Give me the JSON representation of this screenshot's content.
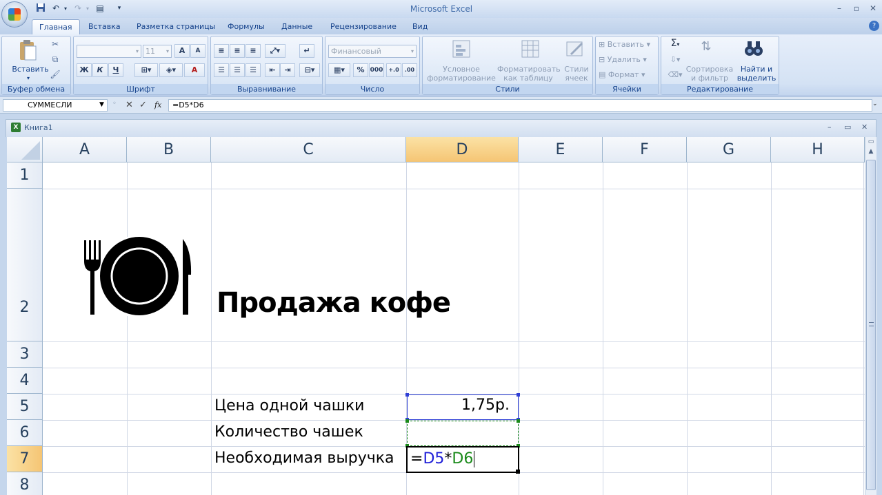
{
  "app": {
    "title": "Microsoft Excel"
  },
  "quick_access": {
    "save_icon": "save-icon",
    "undo_icon": "undo-icon",
    "redo_icon": "redo-icon",
    "customize_icon": "customize-icon"
  },
  "tabs": [
    {
      "label": "Главная",
      "active": true
    },
    {
      "label": "Вставка"
    },
    {
      "label": "Разметка страницы"
    },
    {
      "label": "Формулы"
    },
    {
      "label": "Данные"
    },
    {
      "label": "Рецензирование"
    },
    {
      "label": "Вид"
    }
  ],
  "ribbon": {
    "clipboard": {
      "label": "Буфер обмена",
      "paste": "Вставить"
    },
    "font": {
      "label": "Шрифт",
      "font_size": "11",
      "bold": "Ж",
      "italic": "К",
      "underline": "Ч",
      "grow": "A",
      "shrink": "A",
      "font_color": "A"
    },
    "alignment": {
      "label": "Выравнивание"
    },
    "number": {
      "label": "Число",
      "format": "Финансовый",
      "percent": "%",
      "thousands": "000"
    },
    "styles": {
      "label": "Стили",
      "conditional": "Условное форматирование",
      "as_table": "Форматировать как таблицу",
      "cell_styles": "Стили ячеек"
    },
    "cells": {
      "label": "Ячейки",
      "insert": "Вставить",
      "delete": "Удалить",
      "format": "Формат"
    },
    "editing": {
      "label": "Редактирование",
      "sum": "Σ",
      "sort": "Сортировка и фильтр",
      "find": "Найти и выделить"
    }
  },
  "formula_bar": {
    "name_box": "СУММЕСЛИ",
    "fx": "fx",
    "formula": "=D5*D6"
  },
  "workbook": {
    "title": "Книга1"
  },
  "sheet": {
    "columns": [
      "A",
      "B",
      "C",
      "D",
      "E",
      "F",
      "G",
      "H"
    ],
    "rows": [
      "1",
      "2",
      "3",
      "4",
      "5",
      "6",
      "7",
      "8"
    ],
    "selected_column": "D",
    "selected_row": "7",
    "title": "Продажа кофе",
    "labels": {
      "price": "Цена одной чашки",
      "quantity": "Количество чашек",
      "revenue": "Необходимая выручка"
    },
    "values": {
      "price": "1,75р."
    },
    "editing_formula": {
      "eq": "=",
      "ref1": "D5",
      "op": "*",
      "ref2": "D6"
    },
    "colors": {
      "ref1": "#1f1fd8",
      "ref2": "#1a8a1a"
    },
    "image": "plate-fork-knife-icon"
  }
}
